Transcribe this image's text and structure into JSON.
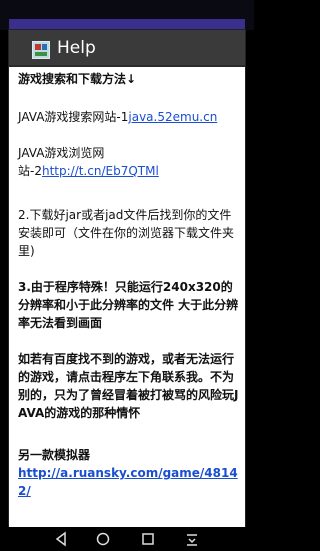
{
  "dialog": {
    "title": "Help",
    "icon": "game-app-icon"
  },
  "content": {
    "heading": "游戏搜索和下载方法↓",
    "site1_prefix": "JAVA游戏搜索网站-1",
    "site1_link": "java.52emu.cn",
    "site2_line1": "JAVA游戏浏览网",
    "site2_prefix": "站-2",
    "site2_link": "http://t.cn/Eb7QTMl",
    "step2": "2.下载好jar或者jad文件后找到你的文件安装即可（文件在你的浏览器下载文件夹里)",
    "step3": "3.由于程序特殊！只能运行240x320的分辨率和小于此分辨率的文件 大于此分辨率无法看到画面",
    "note": "如若有百度找不到的游戏，或者无法运行的游戏，请点击程序左下角联系我。不为别的，只为了曾经冒着被打被骂的风险玩JAVA的游戏的那种情怀",
    "other_heading": "另一款模拟器",
    "other_link": "http://a.ruansky.com/game/48142/"
  },
  "navbar": {
    "back": "back-icon",
    "home": "home-icon",
    "recents": "recents-icon",
    "menu": "menu-down-icon"
  },
  "colors": {
    "titlebar": "#3a3a3a",
    "link": "#1a4fd0",
    "status_accent": "#3b2f8e"
  }
}
